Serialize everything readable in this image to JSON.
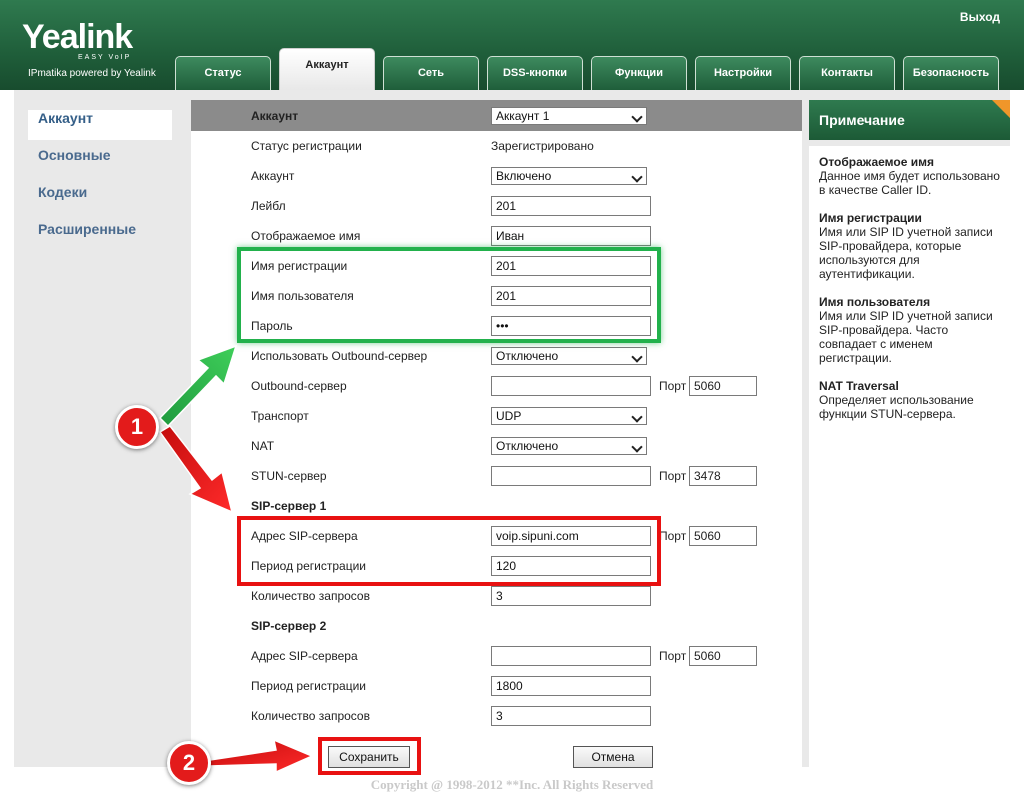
{
  "header": {
    "logo": "Yealink",
    "logo_sub": "EASY VoIP",
    "tagline": "IPmatika powered by Yealink",
    "logout": "Выход"
  },
  "tabs": [
    {
      "label": "Статус"
    },
    {
      "label": "Аккаунт",
      "active": true
    },
    {
      "label": "Сеть"
    },
    {
      "label": "DSS-кнопки"
    },
    {
      "label": "Функции"
    },
    {
      "label": "Настройки"
    },
    {
      "label": "Контакты"
    },
    {
      "label": "Безопасность"
    }
  ],
  "sidebar": {
    "items": [
      {
        "label": "Аккаунт",
        "active": true
      },
      {
        "label": "Основные"
      },
      {
        "label": "Кодеки"
      },
      {
        "label": "Расширенные"
      }
    ]
  },
  "form": {
    "header_label": "Аккаунт",
    "header_select": "Аккаунт 1",
    "reg_status_label": "Статус регистрации",
    "reg_status_value": "Зарегистрировано",
    "account_label": "Аккаунт",
    "account_value": "Включено",
    "label_label": "Лейбл",
    "label_value": "201",
    "display_name_label": "Отображаемое имя",
    "display_name_value": "Иван",
    "reg_name_label": "Имя регистрации",
    "reg_name_value": "201",
    "username_label": "Имя пользователя",
    "username_value": "201",
    "password_label": "Пароль",
    "password_value": "•••",
    "outbound_use_label": "Использовать Outbound-сервер",
    "outbound_use_value": "Отключено",
    "outbound_server_label": "Outbound-сервер",
    "outbound_server_value": "",
    "outbound_port_label": "Порт",
    "outbound_port_value": "5060",
    "transport_label": "Транспорт",
    "transport_value": "UDP",
    "nat_label": "NAT",
    "nat_value": "Отключено",
    "stun_label": "STUN-сервер",
    "stun_value": "",
    "stun_port_label": "Порт",
    "stun_port_value": "3478",
    "sip1_heading": "SIP-сервер 1",
    "sip1_addr_label": "Адрес SIP-сервера",
    "sip1_addr_value": "voip.sipuni.com",
    "sip1_port_label": "Порт",
    "sip1_port_value": "5060",
    "sip1_period_label": "Период регистрации",
    "sip1_period_value": "120",
    "sip1_retries_label": "Количество запросов",
    "sip1_retries_value": "3",
    "sip2_heading": "SIP-сервер 2",
    "sip2_addr_label": "Адрес SIP-сервера",
    "sip2_addr_value": "",
    "sip2_port_label": "Порт",
    "sip2_port_value": "5060",
    "sip2_period_label": "Период регистрации",
    "sip2_period_value": "1800",
    "sip2_retries_label": "Количество запросов",
    "sip2_retries_value": "3",
    "save_button": "Сохранить",
    "cancel_button": "Отмена"
  },
  "note": {
    "title": "Примечание",
    "blocks": [
      {
        "heading": "Отображаемое имя",
        "text": "Данное имя будет использовано в качестве Caller ID."
      },
      {
        "heading": "Имя регистрации",
        "text": "Имя или SIP ID учетной записи SIP-провайдера, которые используются для аутентификации."
      },
      {
        "heading": "Имя пользователя",
        "text": "Имя или SIP ID учетной записи SIP-провайдера. Часто совпадает с именем регистрации."
      },
      {
        "heading": "NAT Traversal",
        "text": "Определяет использование функции STUN-сервера."
      }
    ]
  },
  "footer": {
    "copyright": "Copyright @ 1998-2012 **Inc. All Rights Reserved"
  },
  "annotations": {
    "badge1": "1",
    "badge2": "2",
    "green": "#22b14c",
    "red": "#e81111"
  }
}
